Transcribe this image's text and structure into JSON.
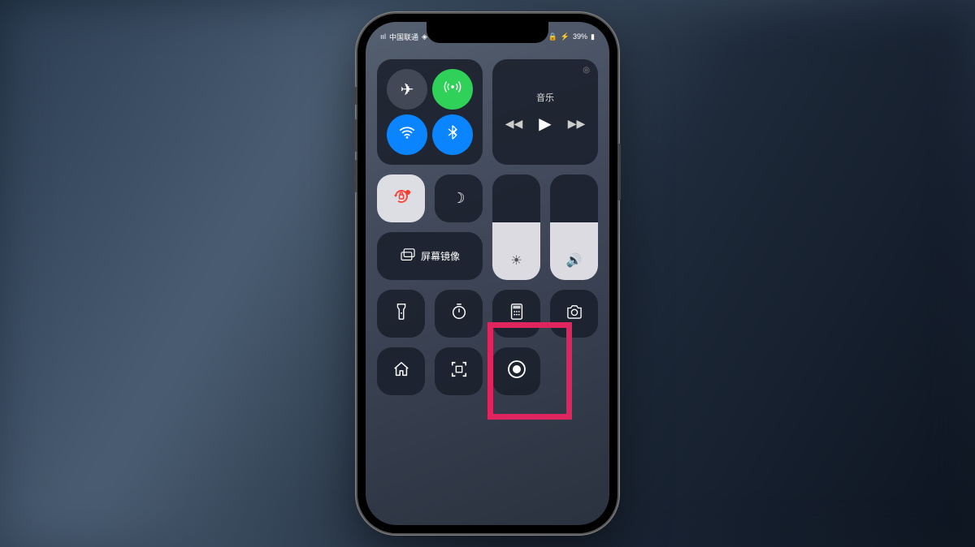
{
  "status": {
    "carrier": "中国联通",
    "signal": "ııl",
    "wifi": "◈",
    "battery_pct": "39%",
    "charging_icon": "⚡",
    "lock_icon": "🔒"
  },
  "connectivity": {
    "airplane": "✈",
    "cellular": "📶",
    "wifi": "◈",
    "bluetooth": "✱"
  },
  "music": {
    "title": "音乐",
    "prev": "◀◀",
    "play": "▶",
    "next": "▶▶",
    "airplay": "◎"
  },
  "toggles": {
    "orientation_lock": "🔒",
    "dnd": "☽",
    "mirroring_icon": "⧉",
    "mirroring_label": "屏幕镜像"
  },
  "sliders": {
    "brightness_icon": "☀",
    "brightness_pct": 55,
    "volume_icon": "🔊",
    "volume_pct": 55
  },
  "shortcuts": {
    "flashlight": "🔦",
    "timer": "⏱",
    "calculator": "🖩",
    "camera": "📷",
    "home": "⌂",
    "scan": "⌗",
    "record": "◉"
  },
  "highlight": {
    "target": "screen-record-button"
  }
}
